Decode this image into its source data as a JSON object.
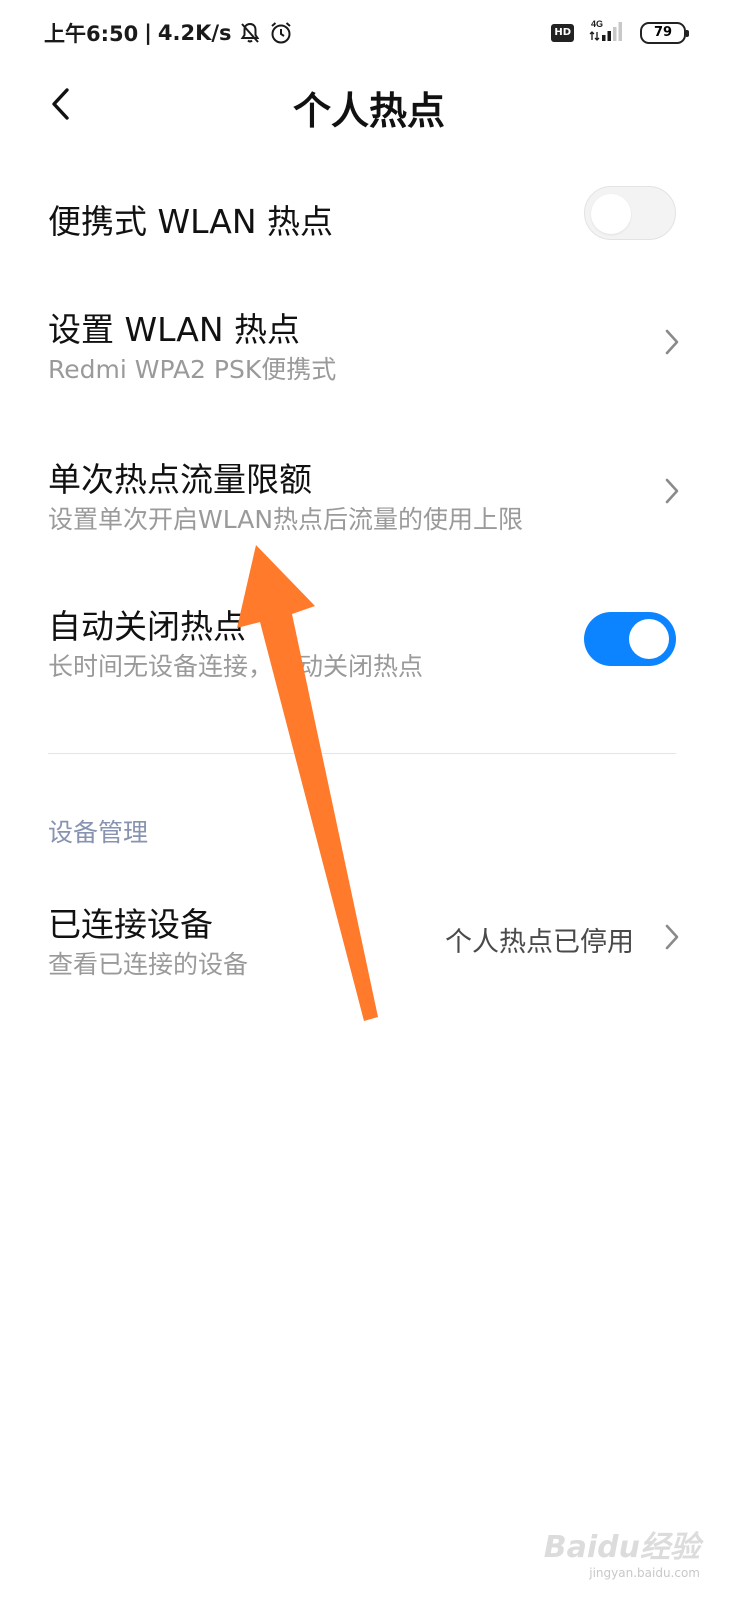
{
  "status_bar": {
    "time": "上午6:50",
    "separator": "|",
    "net_speed": "4.2K/s",
    "hd_badge": "HD",
    "network_type": "4G",
    "battery_level": "79"
  },
  "header": {
    "title": "个人热点"
  },
  "settings": {
    "portable_hotspot": {
      "title": "便携式 WLAN 热点",
      "enabled": false
    },
    "setup_hotspot": {
      "title": "设置 WLAN 热点",
      "subtitle": "Redmi WPA2 PSK便携式"
    },
    "data_limit": {
      "title": "单次热点流量限额",
      "subtitle": "设置单次开启WLAN热点后流量的使用上限"
    },
    "auto_close": {
      "title": "自动关闭热点",
      "subtitle": "长时间无设备连接，自动关闭热点",
      "enabled": true
    }
  },
  "device_management": {
    "section_title": "设备管理",
    "connected_devices": {
      "title": "已连接设备",
      "subtitle": "查看已连接的设备",
      "status": "个人热点已停用"
    }
  },
  "colors": {
    "toggle_on": "#0d84ff",
    "annotation_arrow": "#ff7a2a",
    "section_header": "#8793b0"
  },
  "watermark": {
    "main": "Baidu经验",
    "sub": "jingyan.baidu.com"
  }
}
